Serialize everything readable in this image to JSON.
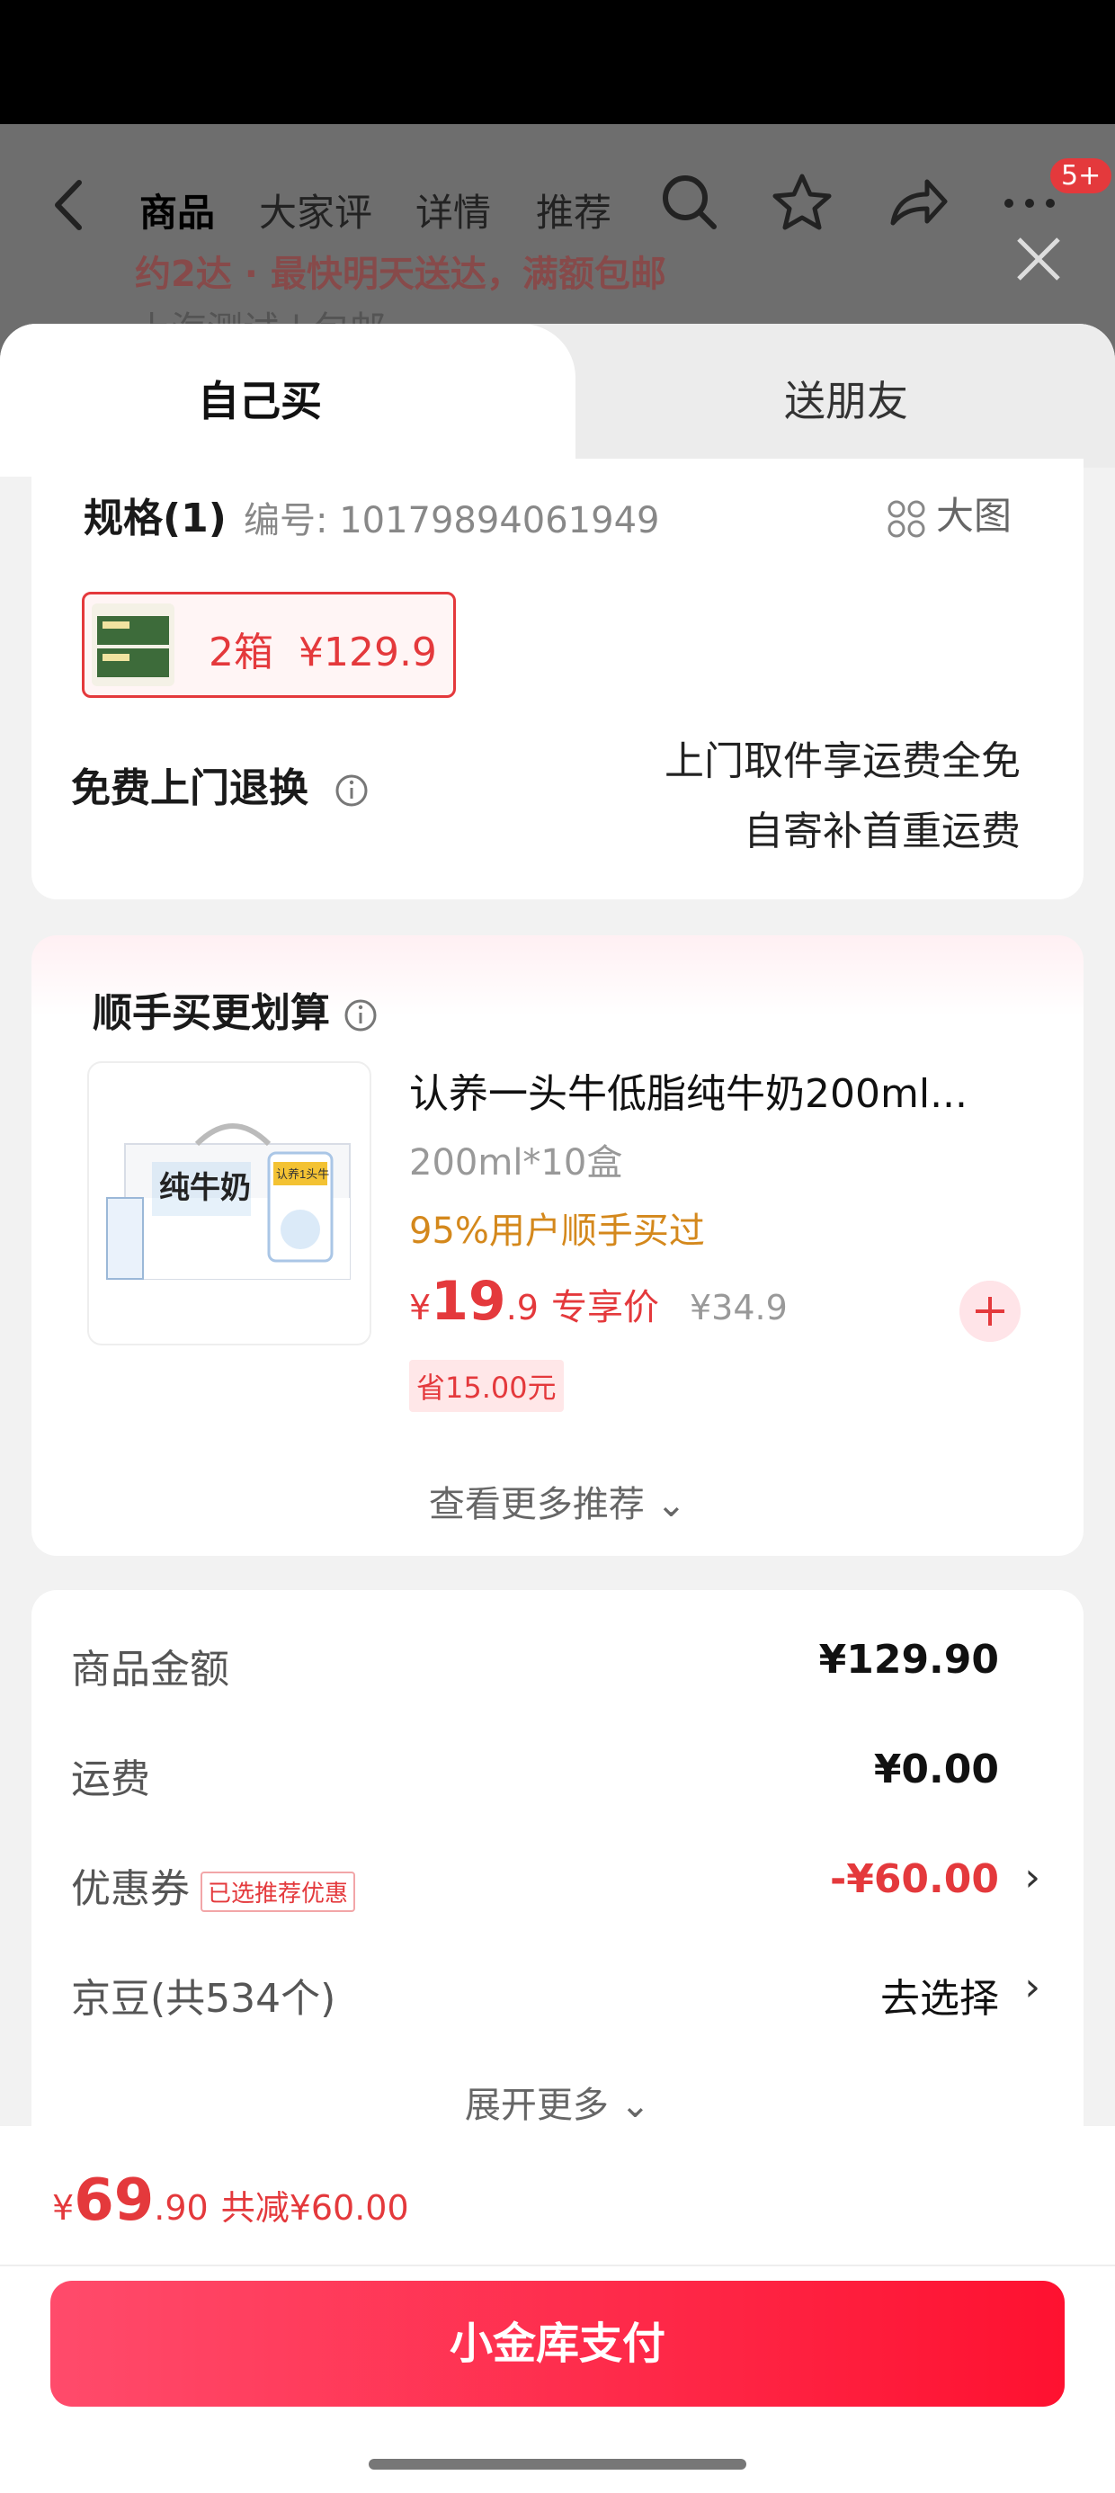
{
  "nav": {
    "tabs": [
      "商品",
      "大家评",
      "详情",
      "推荐"
    ],
    "badge": "5+",
    "dim_text": "约2达 · 最快明天送达，满额包邮",
    "dim_subtext": "上海测试 | 包邮"
  },
  "sheet_tabs": {
    "self": "自己买",
    "friend": "送朋友"
  },
  "spec": {
    "title": "规格(1)",
    "code": "编号: 10179894061949",
    "big_image": "大图",
    "sku": "2箱  ¥129.9"
  },
  "returns": {
    "label": "免费上门退换",
    "line1": "上门取件享运费全免",
    "line2": "自寄补首重运费"
  },
  "bundle": {
    "title": "顺手买更划算",
    "product": {
      "name": "认养一头牛低脂纯牛奶200ml...",
      "spec": "200ml*10盒",
      "buyers": "95%用户顺手买过",
      "price_symbol": "¥",
      "price_int": "19",
      "price_dec": ".9",
      "price_tag": "专享价",
      "orig_price": "¥34.9",
      "save": "省15.00元",
      "box_text": "纯牛奶",
      "brand_text": "认养1头牛"
    },
    "more": "查看更多推荐 ⌄"
  },
  "summary": {
    "goods_label": "商品金额",
    "goods_value": "¥129.90",
    "freight_label": "运费",
    "freight_value": "¥0.00",
    "coupon_label": "优惠券",
    "coupon_tag": "已选推荐优惠",
    "coupon_value": "-¥60.00",
    "beans_label": "京豆(共534个)",
    "beans_value": "去选择",
    "expand": "展开更多 ⌄",
    "chevron": "›"
  },
  "bottom": {
    "price_symbol": "¥",
    "price_int": "69",
    "price_dec": ".90",
    "saved": "共减¥60.00",
    "pay": "小金库支付"
  },
  "colors": {
    "accent": "#e4393c",
    "orange": "#d4881c",
    "pay_gradient_start": "#ff4b6b",
    "pay_gradient_end": "#fe1130"
  }
}
